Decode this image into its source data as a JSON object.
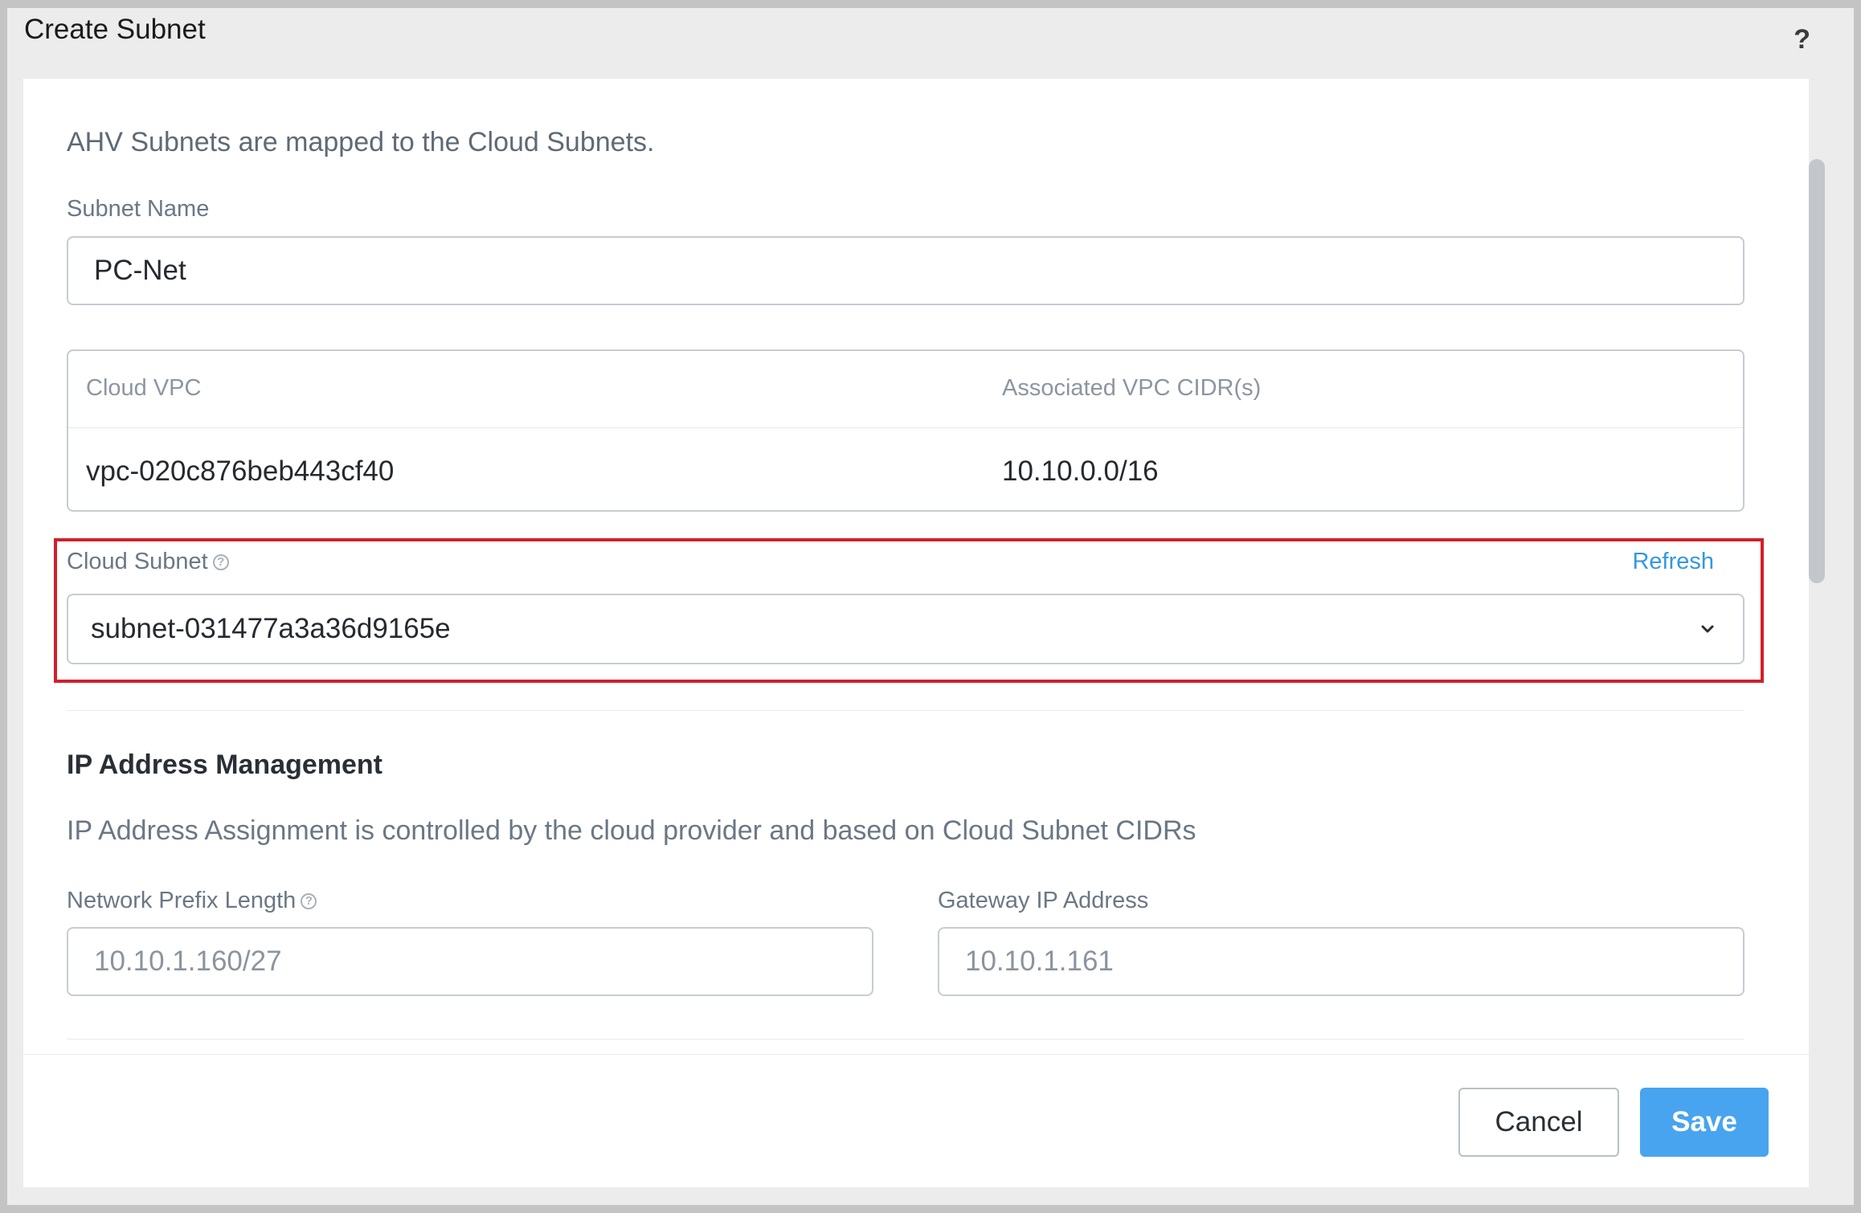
{
  "dialog": {
    "title": "Create Subnet",
    "help_label": "?"
  },
  "intro_text": "AHV Subnets are mapped to the Cloud Subnets.",
  "subnet_name": {
    "label": "Subnet Name",
    "value": "PC-Net"
  },
  "vpc_table": {
    "headers": [
      "Cloud VPC",
      "Associated VPC CIDR(s)"
    ],
    "row": [
      "vpc-020c876beb443cf40",
      "10.10.0.0/16"
    ]
  },
  "cloud_subnet": {
    "label": "Cloud Subnet",
    "refresh_label": "Refresh",
    "selected": "subnet-031477a3a36d9165e"
  },
  "ipam": {
    "title": "IP Address Management",
    "description": "IP Address Assignment is controlled by the cloud provider and based on Cloud Subnet CIDRs",
    "prefix_label": "Network Prefix Length",
    "prefix_value": "10.10.1.160/27",
    "gateway_label": "Gateway IP Address",
    "gateway_value": "10.10.1.161"
  },
  "footer": {
    "cancel_label": "Cancel",
    "save_label": "Save"
  },
  "colors": {
    "highlight": "#d0202a",
    "accent": "#48a4ee",
    "link": "#3498e0"
  },
  "icons": [
    "help-icon",
    "info-icon",
    "chevron-down-icon"
  ]
}
